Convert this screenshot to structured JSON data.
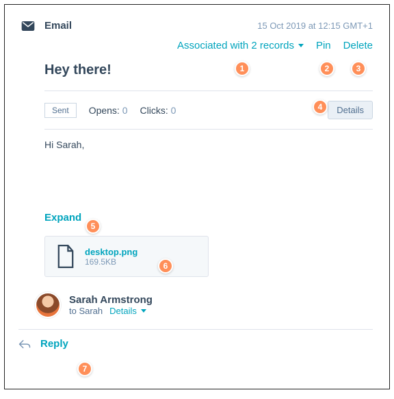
{
  "header": {
    "type_label": "Email",
    "timestamp": "15 Oct 2019 at 12:15 GMT+1"
  },
  "actions": {
    "associated": "Associated with 2 records",
    "pin": "Pin",
    "delete": "Delete"
  },
  "subject": "Hey there!",
  "stats": {
    "sent_badge": "Sent",
    "opens_label": "Opens:",
    "opens_value": "0",
    "clicks_label": "Clicks:",
    "clicks_value": "0",
    "details_button": "Details"
  },
  "body": {
    "greeting": "Hi Sarah,"
  },
  "expand_label": "Expand",
  "attachment": {
    "filename": "desktop.png",
    "filesize": "169.5KB"
  },
  "sender": {
    "name": "Sarah Armstrong",
    "to_line": "to Sarah",
    "details": "Details"
  },
  "footer": {
    "reply": "Reply"
  },
  "markers": {
    "m1": "1",
    "m2": "2",
    "m3": "3",
    "m4": "4",
    "m5": "5",
    "m6": "6",
    "m7": "7"
  }
}
